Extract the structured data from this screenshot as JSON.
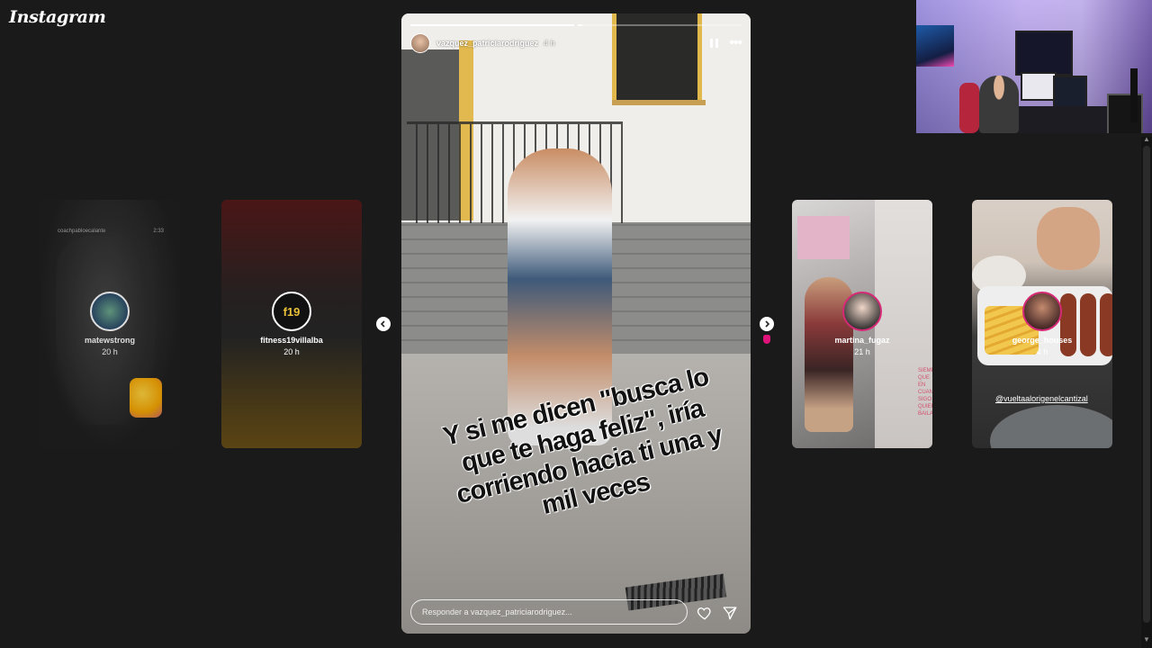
{
  "app": {
    "logo": "Instagram"
  },
  "stories_left": [
    {
      "username": "matewstrong",
      "time": "20 h",
      "overlay_name": "coachpabloecalante",
      "overlay_time": "2:33"
    },
    {
      "username": "fitness19villalba",
      "time": "20 h",
      "avatar_text": "f19"
    }
  ],
  "current_story": {
    "username": "vazquez_patriciarodriguez",
    "time": "4 h",
    "caption": "Y si me dicen \"busca lo que te haga feliz\", iría corriendo hacia ti una y mil veces",
    "reply_placeholder": "Responder a vazquez_patriciarodriguez...",
    "progress": [
      1.0,
      0.03
    ]
  },
  "stories_right": [
    {
      "username": "martina_fugaz",
      "time": "21 h",
      "overlay_text": "SIEMPRE QUE EN CUANDO SIGO QUIERO BAILANDO"
    },
    {
      "username": "george_houses",
      "time": "4 h",
      "mention": "@vueltaalorigenelcantizal"
    }
  ],
  "icons": {
    "pause": "pause-icon",
    "more": "more-icon",
    "heart": "heart-icon",
    "send": "send-icon",
    "prev": "chevron-left-icon",
    "next": "chevron-right-icon"
  },
  "colors": {
    "background": "#1a1a1a",
    "accent": "#e0137a",
    "ring": "#d62976"
  }
}
